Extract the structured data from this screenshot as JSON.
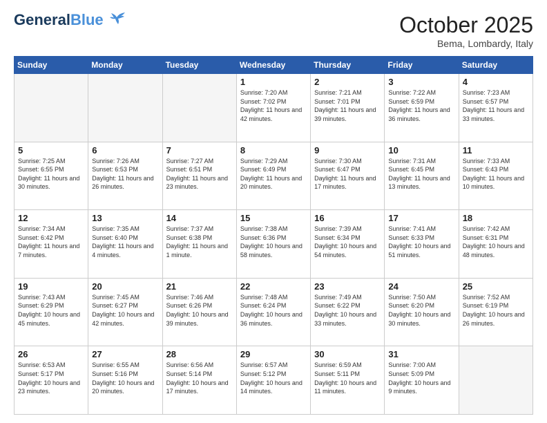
{
  "header": {
    "logo_general": "General",
    "logo_blue": "Blue",
    "month_title": "October 2025",
    "location": "Bema, Lombardy, Italy"
  },
  "weekdays": [
    "Sunday",
    "Monday",
    "Tuesday",
    "Wednesday",
    "Thursday",
    "Friday",
    "Saturday"
  ],
  "weeks": [
    [
      {
        "day": "",
        "info": ""
      },
      {
        "day": "",
        "info": ""
      },
      {
        "day": "",
        "info": ""
      },
      {
        "day": "1",
        "info": "Sunrise: 7:20 AM\nSunset: 7:02 PM\nDaylight: 11 hours and 42 minutes."
      },
      {
        "day": "2",
        "info": "Sunrise: 7:21 AM\nSunset: 7:01 PM\nDaylight: 11 hours and 39 minutes."
      },
      {
        "day": "3",
        "info": "Sunrise: 7:22 AM\nSunset: 6:59 PM\nDaylight: 11 hours and 36 minutes."
      },
      {
        "day": "4",
        "info": "Sunrise: 7:23 AM\nSunset: 6:57 PM\nDaylight: 11 hours and 33 minutes."
      }
    ],
    [
      {
        "day": "5",
        "info": "Sunrise: 7:25 AM\nSunset: 6:55 PM\nDaylight: 11 hours and 30 minutes."
      },
      {
        "day": "6",
        "info": "Sunrise: 7:26 AM\nSunset: 6:53 PM\nDaylight: 11 hours and 26 minutes."
      },
      {
        "day": "7",
        "info": "Sunrise: 7:27 AM\nSunset: 6:51 PM\nDaylight: 11 hours and 23 minutes."
      },
      {
        "day": "8",
        "info": "Sunrise: 7:29 AM\nSunset: 6:49 PM\nDaylight: 11 hours and 20 minutes."
      },
      {
        "day": "9",
        "info": "Sunrise: 7:30 AM\nSunset: 6:47 PM\nDaylight: 11 hours and 17 minutes."
      },
      {
        "day": "10",
        "info": "Sunrise: 7:31 AM\nSunset: 6:45 PM\nDaylight: 11 hours and 13 minutes."
      },
      {
        "day": "11",
        "info": "Sunrise: 7:33 AM\nSunset: 6:43 PM\nDaylight: 11 hours and 10 minutes."
      }
    ],
    [
      {
        "day": "12",
        "info": "Sunrise: 7:34 AM\nSunset: 6:42 PM\nDaylight: 11 hours and 7 minutes."
      },
      {
        "day": "13",
        "info": "Sunrise: 7:35 AM\nSunset: 6:40 PM\nDaylight: 11 hours and 4 minutes."
      },
      {
        "day": "14",
        "info": "Sunrise: 7:37 AM\nSunset: 6:38 PM\nDaylight: 11 hours and 1 minute."
      },
      {
        "day": "15",
        "info": "Sunrise: 7:38 AM\nSunset: 6:36 PM\nDaylight: 10 hours and 58 minutes."
      },
      {
        "day": "16",
        "info": "Sunrise: 7:39 AM\nSunset: 6:34 PM\nDaylight: 10 hours and 54 minutes."
      },
      {
        "day": "17",
        "info": "Sunrise: 7:41 AM\nSunset: 6:33 PM\nDaylight: 10 hours and 51 minutes."
      },
      {
        "day": "18",
        "info": "Sunrise: 7:42 AM\nSunset: 6:31 PM\nDaylight: 10 hours and 48 minutes."
      }
    ],
    [
      {
        "day": "19",
        "info": "Sunrise: 7:43 AM\nSunset: 6:29 PM\nDaylight: 10 hours and 45 minutes."
      },
      {
        "day": "20",
        "info": "Sunrise: 7:45 AM\nSunset: 6:27 PM\nDaylight: 10 hours and 42 minutes."
      },
      {
        "day": "21",
        "info": "Sunrise: 7:46 AM\nSunset: 6:26 PM\nDaylight: 10 hours and 39 minutes."
      },
      {
        "day": "22",
        "info": "Sunrise: 7:48 AM\nSunset: 6:24 PM\nDaylight: 10 hours and 36 minutes."
      },
      {
        "day": "23",
        "info": "Sunrise: 7:49 AM\nSunset: 6:22 PM\nDaylight: 10 hours and 33 minutes."
      },
      {
        "day": "24",
        "info": "Sunrise: 7:50 AM\nSunset: 6:20 PM\nDaylight: 10 hours and 30 minutes."
      },
      {
        "day": "25",
        "info": "Sunrise: 7:52 AM\nSunset: 6:19 PM\nDaylight: 10 hours and 26 minutes."
      }
    ],
    [
      {
        "day": "26",
        "info": "Sunrise: 6:53 AM\nSunset: 5:17 PM\nDaylight: 10 hours and 23 minutes."
      },
      {
        "day": "27",
        "info": "Sunrise: 6:55 AM\nSunset: 5:16 PM\nDaylight: 10 hours and 20 minutes."
      },
      {
        "day": "28",
        "info": "Sunrise: 6:56 AM\nSunset: 5:14 PM\nDaylight: 10 hours and 17 minutes."
      },
      {
        "day": "29",
        "info": "Sunrise: 6:57 AM\nSunset: 5:12 PM\nDaylight: 10 hours and 14 minutes."
      },
      {
        "day": "30",
        "info": "Sunrise: 6:59 AM\nSunset: 5:11 PM\nDaylight: 10 hours and 11 minutes."
      },
      {
        "day": "31",
        "info": "Sunrise: 7:00 AM\nSunset: 5:09 PM\nDaylight: 10 hours and 9 minutes."
      },
      {
        "day": "",
        "info": ""
      }
    ]
  ]
}
